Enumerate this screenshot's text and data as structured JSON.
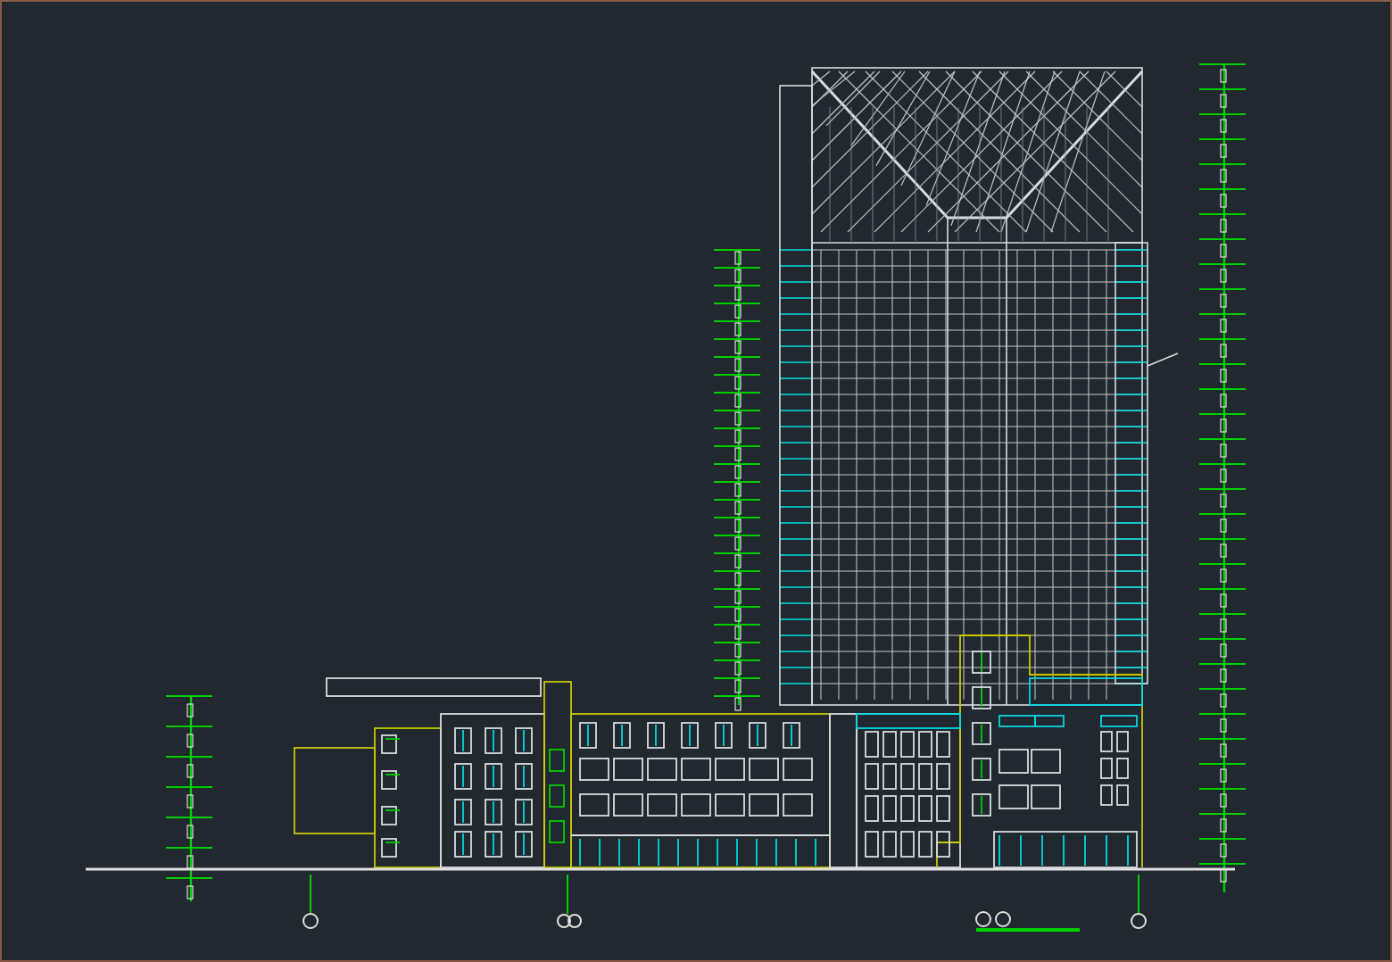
{
  "elevation": {
    "level_markers_shown": true,
    "grid_axes_shown": true
  }
}
